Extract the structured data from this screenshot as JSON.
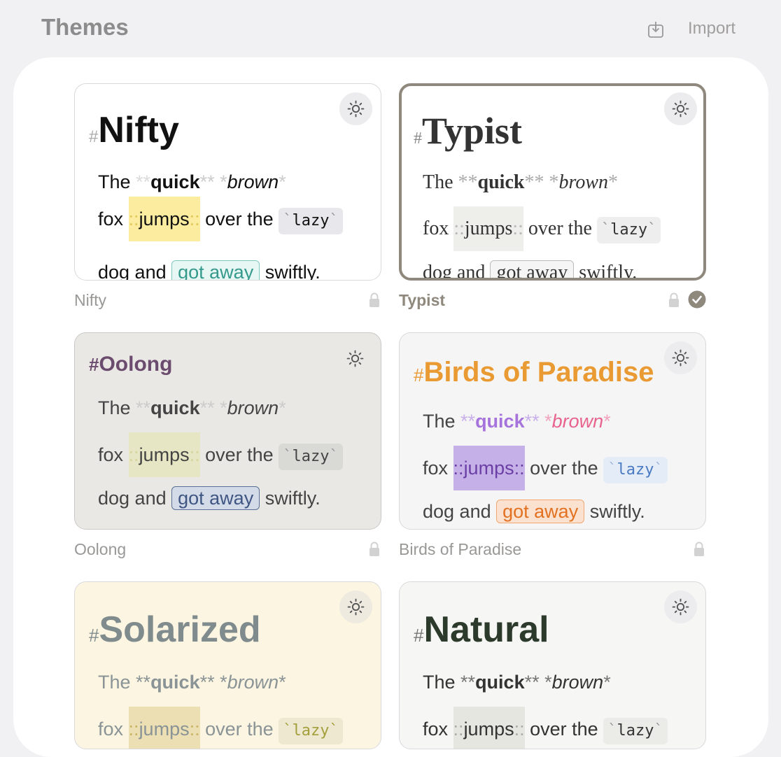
{
  "header": {
    "title": "Themes",
    "import_label": "Import",
    "import_icon": "import-icon"
  },
  "sample": {
    "the": "The",
    "bold_marker": "**",
    "quick": "quick",
    "ital_marker": "*",
    "brown": "brown",
    "fox": "fox",
    "hl_marker": "::",
    "jumps": "jumps",
    "over_the": "over the",
    "code_tick": "`",
    "lazy": "lazy",
    "dog_and": "dog and",
    "got_away": "got away",
    "swiftly": "swiftly.",
    "hash": "#"
  },
  "themes": [
    {
      "name": "Nifty",
      "caption": "Nifty",
      "selected": false,
      "locked": true
    },
    {
      "name": "Typist",
      "caption": "Typist",
      "selected": true,
      "locked": true
    },
    {
      "name": "Oolong",
      "caption": "Oolong",
      "selected": false,
      "locked": true
    },
    {
      "name": "Birds of Paradise",
      "caption": "Birds of Paradise",
      "selected": false,
      "locked": true
    },
    {
      "name": "Solarized",
      "caption": "Solarized",
      "selected": false,
      "locked": false
    },
    {
      "name": "Natural",
      "caption": "Natural",
      "selected": false,
      "locked": false
    }
  ],
  "icons": {
    "mode": "sun-icon",
    "lock": "lock-icon",
    "selected": "checkmark-icon"
  },
  "colors": {
    "nifty_highlight": "#fcec9f",
    "typist_border": "#8f887d",
    "oolong_title": "#6b4b6e",
    "birds_title": "#e99a32",
    "birds_quick": "#a573db",
    "birds_brown": "#e8638d",
    "solarized_bg": "#fcf5e2",
    "natural_title": "#2c3a2c"
  }
}
